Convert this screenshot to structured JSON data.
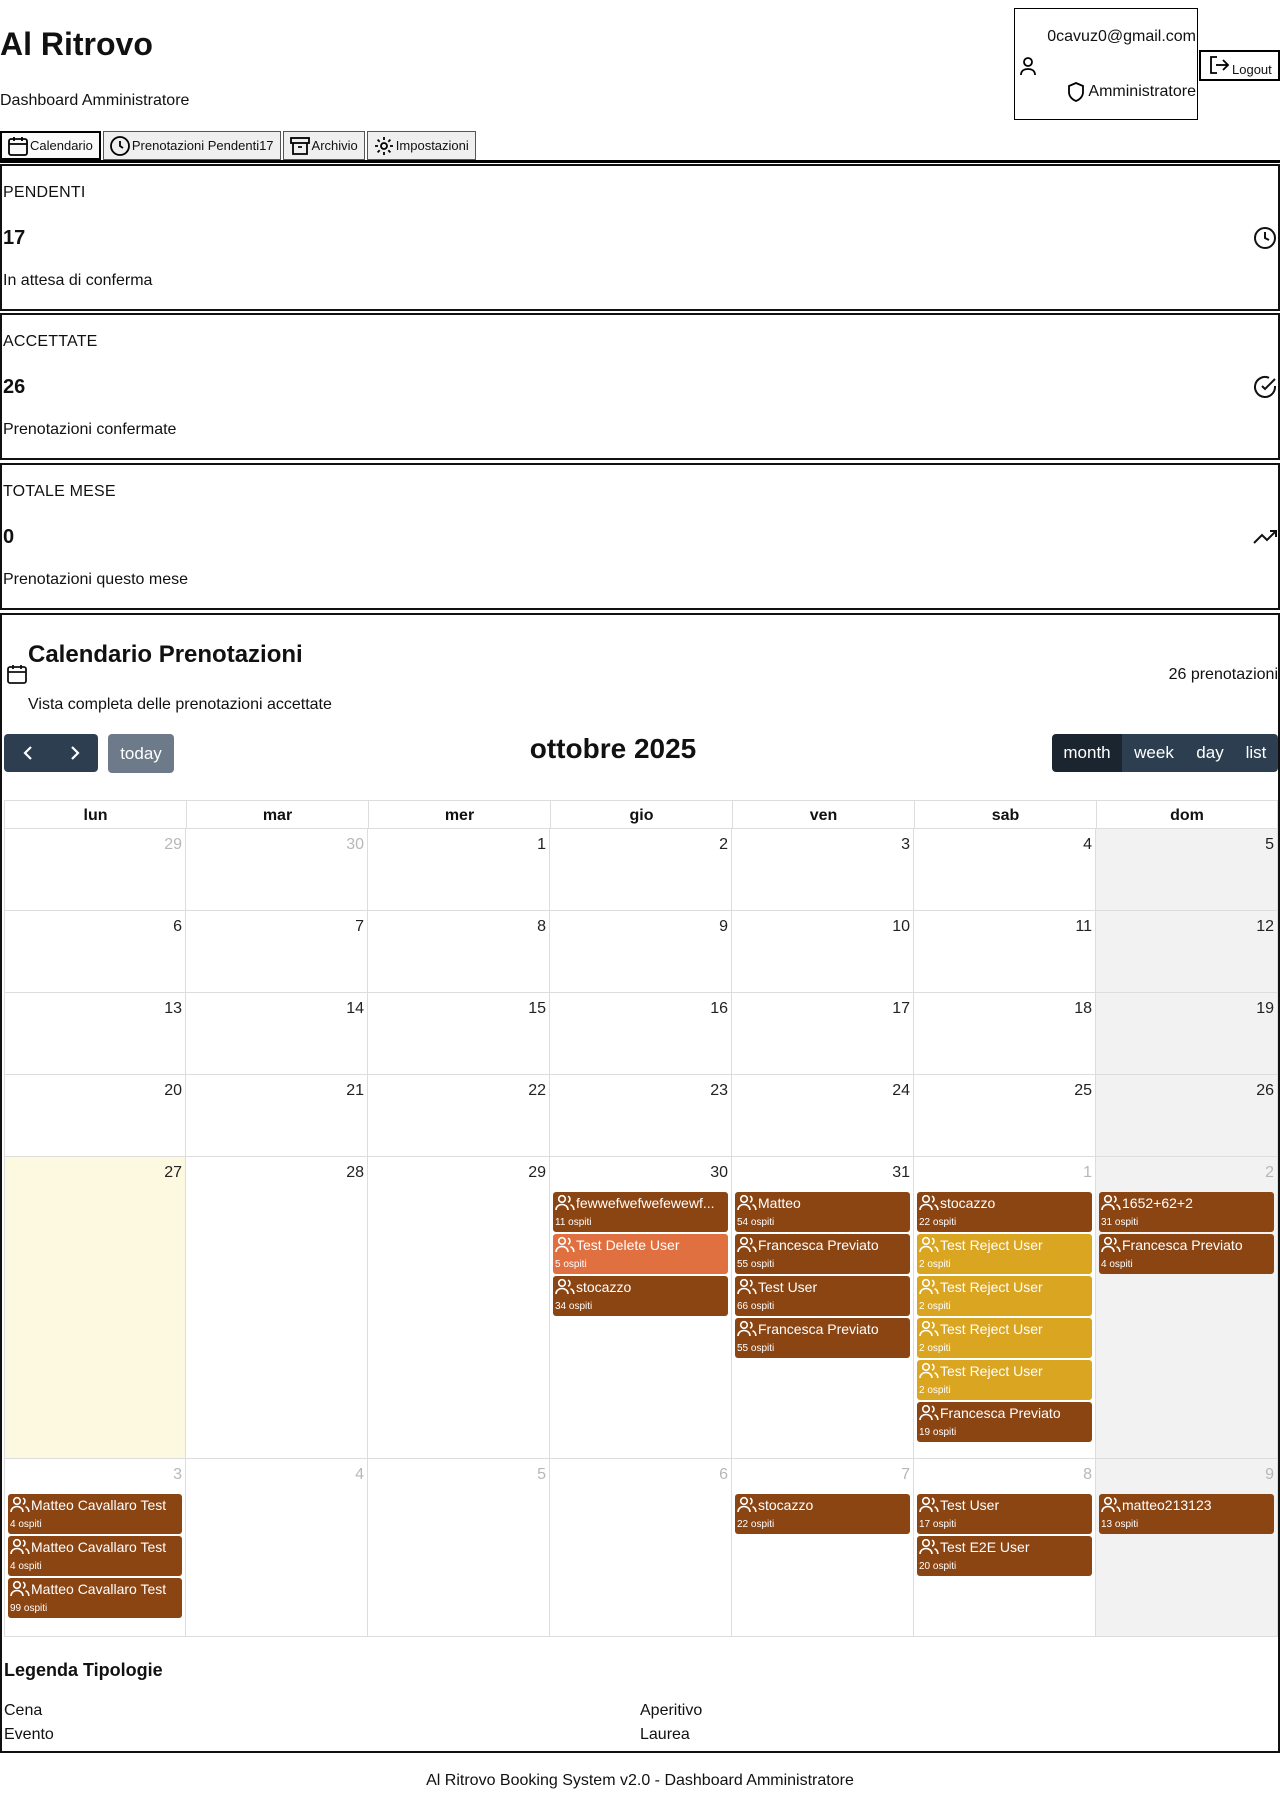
{
  "header": {
    "title": "Al Ritrovo",
    "subtitle": "Dashboard Amministratore",
    "user_email": "0cavuz0@gmail.com",
    "user_role": "Amministratore",
    "logout_label": "Logout"
  },
  "tabs": [
    {
      "label": "Calendario",
      "icon": "calendar-icon",
      "active": true
    },
    {
      "label": "Prenotazioni Pendenti17",
      "icon": "clock-icon",
      "active": false
    },
    {
      "label": "Archivio",
      "icon": "archive-icon",
      "active": false
    },
    {
      "label": "Impostazioni",
      "icon": "gear-icon",
      "active": false
    }
  ],
  "stats": [
    {
      "label": "PENDENTI",
      "value": "17",
      "description": "In attesa di conferma",
      "icon": "clock-icon"
    },
    {
      "label": "ACCETTATE",
      "value": "26",
      "description": "Prenotazioni confermate",
      "icon": "check-circle-icon"
    },
    {
      "label": "TOTALE MESE",
      "value": "0",
      "description": "Prenotazioni questo mese",
      "icon": "trending-up-icon"
    }
  ],
  "calendar": {
    "title": "Calendario Prenotazioni",
    "subtitle": "Vista completa delle prenotazioni accettate",
    "count_label": "26 prenotazioni",
    "month_title": "ottobre 2025",
    "today_label": "today",
    "prev_icon": "chevron-left-icon",
    "next_icon": "chevron-right-icon",
    "views": [
      {
        "label": "month",
        "active": true
      },
      {
        "label": "week",
        "active": false
      },
      {
        "label": "day",
        "active": false
      },
      {
        "label": "list",
        "active": false
      }
    ],
    "weekdays": [
      "lun",
      "mar",
      "mer",
      "gio",
      "ven",
      "sab",
      "dom"
    ],
    "weeks": [
      [
        {
          "day": "29",
          "other": true
        },
        {
          "day": "30",
          "other": true
        },
        {
          "day": "1"
        },
        {
          "day": "2"
        },
        {
          "day": "3"
        },
        {
          "day": "4"
        },
        {
          "day": "5"
        }
      ],
      [
        {
          "day": "6"
        },
        {
          "day": "7"
        },
        {
          "day": "8"
        },
        {
          "day": "9"
        },
        {
          "day": "10"
        },
        {
          "day": "11"
        },
        {
          "day": "12"
        }
      ],
      [
        {
          "day": "13"
        },
        {
          "day": "14"
        },
        {
          "day": "15"
        },
        {
          "day": "16"
        },
        {
          "day": "17"
        },
        {
          "day": "18"
        },
        {
          "day": "19"
        }
      ],
      [
        {
          "day": "20"
        },
        {
          "day": "21"
        },
        {
          "day": "22"
        },
        {
          "day": "23"
        },
        {
          "day": "24"
        },
        {
          "day": "25"
        },
        {
          "day": "26"
        }
      ],
      [
        {
          "day": "27",
          "today": true,
          "events": []
        },
        {
          "day": "28",
          "events": []
        },
        {
          "day": "29",
          "events": []
        },
        {
          "day": "30",
          "events": [
            {
              "name": "fewwefwefwefewewf...",
              "guests": "11 ospiti",
              "color": "#8b4513"
            },
            {
              "name": "Test Delete User",
              "guests": "5 ospiti",
              "color": "#e07040"
            },
            {
              "name": "stocazzo",
              "guests": "34 ospiti",
              "color": "#8b4513"
            }
          ]
        },
        {
          "day": "31",
          "events": [
            {
              "name": "Matteo",
              "guests": "54 ospiti",
              "color": "#8b4513"
            },
            {
              "name": "Francesca Previato",
              "guests": "55 ospiti",
              "color": "#8b4513"
            },
            {
              "name": "Test User",
              "guests": "66 ospiti",
              "color": "#8b4513"
            },
            {
              "name": "Francesca Previato",
              "guests": "55 ospiti",
              "color": "#8b4513"
            }
          ]
        },
        {
          "day": "1",
          "other": true,
          "events": [
            {
              "name": "stocazzo",
              "guests": "22 ospiti",
              "color": "#8b4513"
            },
            {
              "name": "Test Reject User",
              "guests": "2 ospiti",
              "color": "#daa520"
            },
            {
              "name": "Test Reject User",
              "guests": "2 ospiti",
              "color": "#daa520"
            },
            {
              "name": "Test Reject User",
              "guests": "2 ospiti",
              "color": "#daa520"
            },
            {
              "name": "Test Reject User",
              "guests": "2 ospiti",
              "color": "#daa520"
            },
            {
              "name": "Francesca Previato",
              "guests": "19 ospiti",
              "color": "#8b4513"
            }
          ]
        },
        {
          "day": "2",
          "other": true,
          "events": [
            {
              "name": "1652+62+2",
              "guests": "31 ospiti",
              "color": "#8b4513"
            },
            {
              "name": "Francesca Previato",
              "guests": "4 ospiti",
              "color": "#8b4513"
            }
          ]
        }
      ],
      [
        {
          "day": "3",
          "other": true,
          "events": [
            {
              "name": "Matteo Cavallaro Test",
              "guests": "4 ospiti",
              "color": "#8b4513"
            },
            {
              "name": "Matteo Cavallaro Test",
              "guests": "4 ospiti",
              "color": "#8b4513"
            },
            {
              "name": "Matteo Cavallaro Test",
              "guests": "99 ospiti",
              "color": "#8b4513"
            }
          ]
        },
        {
          "day": "4",
          "other": true,
          "events": []
        },
        {
          "day": "5",
          "other": true,
          "events": []
        },
        {
          "day": "6",
          "other": true,
          "events": []
        },
        {
          "day": "7",
          "other": true,
          "events": [
            {
              "name": "stocazzo",
              "guests": "22 ospiti",
              "color": "#8b4513"
            }
          ]
        },
        {
          "day": "8",
          "other": true,
          "events": [
            {
              "name": "Test User",
              "guests": "17 ospiti",
              "color": "#8b4513"
            },
            {
              "name": "Test E2E User",
              "guests": "20 ospiti",
              "color": "#8b4513"
            }
          ]
        },
        {
          "day": "9",
          "other": true,
          "events": [
            {
              "name": "matteo213123",
              "guests": "13 ospiti",
              "color": "#8b4513"
            }
          ]
        }
      ]
    ]
  },
  "legend": {
    "title": "Legenda Tipologie",
    "items": [
      "Cena",
      "Aperitivo",
      "Evento",
      "Laurea"
    ]
  },
  "footer": {
    "text": "Al Ritrovo Booking System v2.0 - Dashboard Amministratore"
  },
  "colors": {
    "event_brown": "#8b4513",
    "event_gold": "#daa520",
    "event_orange": "#e07040",
    "toolbar_dark": "#2c3e50",
    "today_bg": "#fdf8e0"
  }
}
